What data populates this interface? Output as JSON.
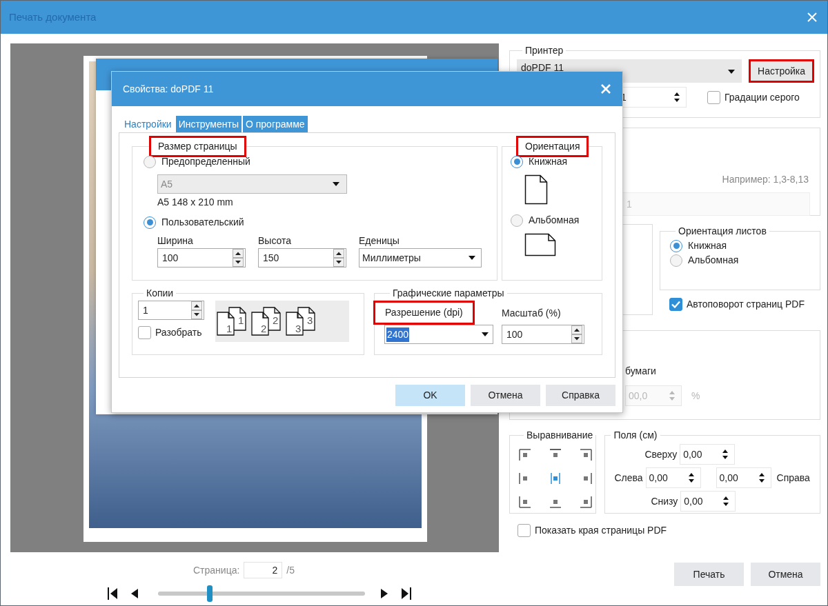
{
  "window": {
    "title": "Печать документа"
  },
  "preview": {
    "page_label": "Страница:",
    "page": "2",
    "page_total": "/5",
    "slider": {
      "level": 0.25
    }
  },
  "printer_group": {
    "title": "Принтер",
    "printer": "doPDF 11",
    "setup_button": {
      "label": "Настройка",
      "highlighted": true
    },
    "copies": "1",
    "grayscale": {
      "label": "Градации серого",
      "checked": false
    }
  },
  "pages_group": {
    "hint": "Например: 1,3-8,13",
    "value": "1"
  },
  "sheet_orientation": {
    "title": "Ориентация листов",
    "options": [
      {
        "label": "Книжная",
        "selected": true
      },
      {
        "label": "Альбомная",
        "selected": false
      }
    ]
  },
  "autorotate": {
    "label": "Автоповорот страниц PDF",
    "checked": true
  },
  "scale_group": {
    "fragment": "бумаги",
    "custom_value": "00,0",
    "unit": "%"
  },
  "alignment": {
    "title": "Выравнивание",
    "cells": [
      {
        "selected": false
      },
      {
        "selected": false
      },
      {
        "selected": false
      },
      {
        "selected": false
      },
      {
        "selected": true
      },
      {
        "selected": false
      },
      {
        "selected": false
      },
      {
        "selected": false
      },
      {
        "selected": false
      }
    ]
  },
  "margins": {
    "title": "Поля (см)",
    "top": {
      "label": "Сверху",
      "value": "0,00"
    },
    "left": {
      "label": "Слева",
      "value": "0,00"
    },
    "right": {
      "label": "Справа",
      "value": "0,00"
    },
    "bottom": {
      "label": "Снизу",
      "value": "0,00"
    }
  },
  "show_edges": {
    "label": "Показать края страницы PDF",
    "checked": false
  },
  "buttons": [
    "Печать",
    "Отмена"
  ],
  "dialog": {
    "title": "Свойства: doPDF 11",
    "tabs": [
      {
        "label": "Настройки",
        "selected": true
      },
      {
        "label": "Инструменты",
        "selected": false
      },
      {
        "label": "О программе",
        "selected": false
      }
    ],
    "page_size": {
      "title": "Размер страницы",
      "highlighted": true,
      "options": [
        {
          "label": "Предопределенный",
          "selected": false
        },
        {
          "label": "Пользовательский",
          "selected": true
        }
      ],
      "preset": "A5",
      "preset_desc": "A5 148 x 210 mm",
      "width": {
        "label": "Ширина",
        "value": "100"
      },
      "height": {
        "label": "Высота",
        "value": "150"
      },
      "units": {
        "label": "Еденицы",
        "value": "Миллиметры"
      }
    },
    "orientation": {
      "title": "Ориентация",
      "highlighted": true,
      "options": [
        {
          "label": "Книжная",
          "selected": true,
          "kind": "portrait"
        },
        {
          "label": "Альбомная",
          "selected": false,
          "kind": "landscape"
        }
      ]
    },
    "copies": {
      "title": "Копии",
      "value": "1",
      "collate": {
        "label": "Разобрать",
        "checked": false
      },
      "stacks": [
        {
          "front": "1",
          "back": "1"
        },
        {
          "front": "2",
          "back": "2"
        },
        {
          "front": "3",
          "back": "3"
        }
      ]
    },
    "graphics": {
      "title": "Графические параметры",
      "resolution": {
        "label": "Разрешение (dpi)",
        "value": "2400",
        "highlighted": true
      },
      "scale": {
        "label": "Масштаб (%)",
        "value": "100"
      }
    },
    "buttons": [
      {
        "label": "OK",
        "default": true
      },
      {
        "label": "Отмена",
        "default": false
      },
      {
        "label": "Справка",
        "default": false
      }
    ]
  }
}
